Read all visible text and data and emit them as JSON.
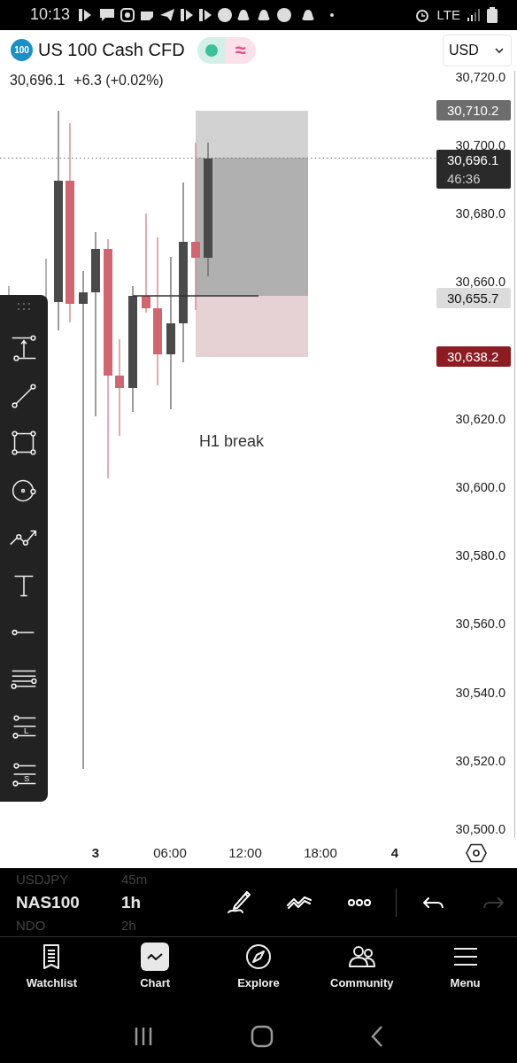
{
  "status_bar": {
    "time": "10:13",
    "network": "LTE"
  },
  "instrument": {
    "logo": "100",
    "title": "US 100 Cash CFD",
    "delayed_mark": "≈",
    "currency": "USD",
    "price": "30,696.1",
    "change": "+6.3 (+0.02%)"
  },
  "price_axis": [
    "30,720.0",
    "30,700.0",
    "30,680.0",
    "30,660.0",
    "30,620.0",
    "30,600.0",
    "30,580.0",
    "30,560.0",
    "30,540.0",
    "30,520.0",
    "30,500.0"
  ],
  "price_badges": [
    {
      "kind": "target",
      "label": "30,710.2"
    },
    {
      "kind": "last",
      "label": "30,696.1",
      "countdown": "46:36"
    },
    {
      "kind": "entry",
      "label": "30,655.7"
    },
    {
      "kind": "stop",
      "label": "30,638.2"
    }
  ],
  "annotation": "H1 break",
  "drawing_tools": [
    {
      "kind": "range"
    },
    {
      "kind": "trend"
    },
    {
      "kind": "rect"
    },
    {
      "kind": "circle"
    },
    {
      "kind": "path"
    },
    {
      "kind": "text"
    },
    {
      "kind": "ray"
    },
    {
      "kind": "lines"
    },
    {
      "kind": "long",
      "label": "L"
    },
    {
      "kind": "short",
      "label": "S"
    }
  ],
  "time_axis": [
    {
      "label": "3",
      "bold": true
    },
    {
      "label": "06:00",
      "bold": false
    },
    {
      "label": "12:00",
      "bold": false
    },
    {
      "label": "18:00",
      "bold": false
    },
    {
      "label": "4",
      "bold": true
    }
  ],
  "symbols": [
    {
      "symbol": "USDJPY",
      "interval": "45m",
      "selected": false
    },
    {
      "symbol": "NAS100",
      "interval": "1h",
      "selected": true
    },
    {
      "symbol": "NDO",
      "interval": "2h",
      "selected": false
    }
  ],
  "chart_tools": [
    {
      "kind": "draw",
      "disabled": false
    },
    {
      "kind": "chart-type",
      "disabled": false
    },
    {
      "kind": "more",
      "disabled": false
    },
    {
      "kind": "undo",
      "disabled": false
    },
    {
      "kind": "redo",
      "disabled": true
    }
  ],
  "nav": [
    {
      "kind": "watchlist",
      "label": "Watchlist",
      "selected": false
    },
    {
      "kind": "chart",
      "label": "Chart",
      "selected": true
    },
    {
      "kind": "explore",
      "label": "Explore",
      "selected": false
    },
    {
      "kind": "community",
      "label": "Community",
      "selected": false
    },
    {
      "kind": "menu",
      "label": "Menu",
      "selected": false
    }
  ]
}
